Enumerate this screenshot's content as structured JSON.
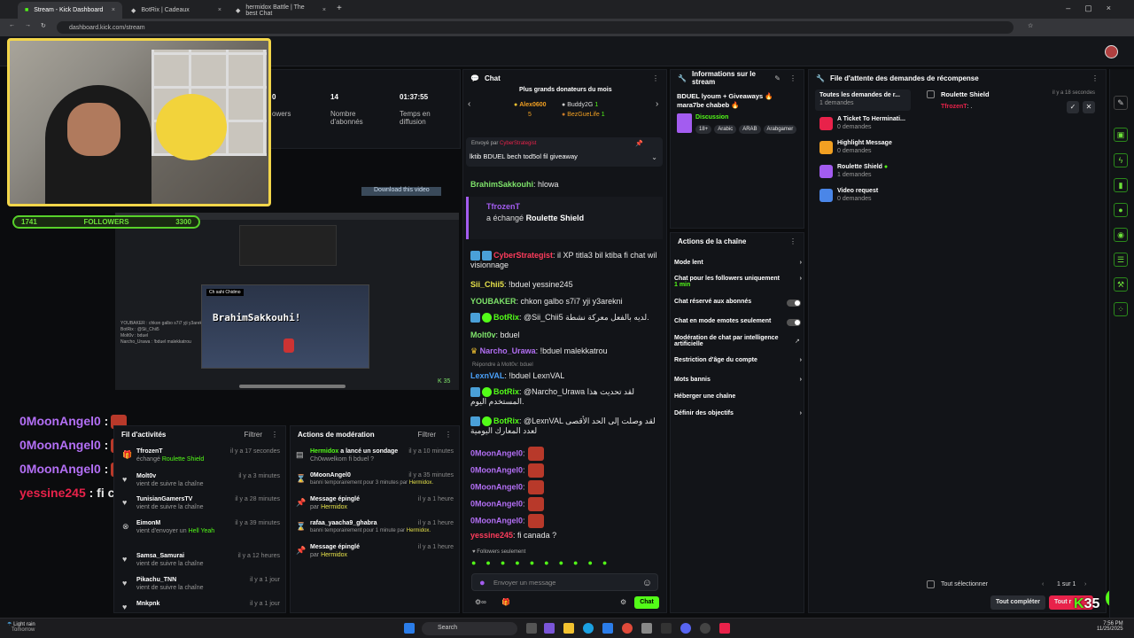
{
  "browser": {
    "tabs": [
      {
        "label": "Stream - Kick Dashboard",
        "active": true
      },
      {
        "label": "BotRix | Cadeaux",
        "active": false
      },
      {
        "label": "hermidox Battle | The best Chat",
        "active": false
      }
    ],
    "url": "dashboard.kick.com/stream"
  },
  "stats": [
    {
      "value": "0",
      "label": "owers"
    },
    {
      "value": "14",
      "label": "Nombre d'abonnés"
    },
    {
      "value": "01:37:55",
      "label": "Temps en diffusion"
    }
  ],
  "overlay": {
    "followers_current": "1741",
    "followers_label": "FOLLOWERS",
    "followers_goal": "3300",
    "download_label": "Download this video",
    "game_title": "BrahimSakkouhi!",
    "counter": "35",
    "chat": [
      {
        "user": "0MoonAngel0",
        "sep": " :",
        "color": "purple"
      },
      {
        "user": "0MoonAngel0",
        "sep": " :",
        "color": "purple"
      },
      {
        "user": "0MoonAngel0",
        "sep": " :",
        "color": "purple"
      },
      {
        "user": "yessine245",
        "sep": " : fi canada ?",
        "color": "red"
      }
    ]
  },
  "activity": {
    "title": "Fil d'activités",
    "filter": "Filtrer",
    "items": [
      {
        "name": "TfrozenT",
        "sub": "échangé",
        "sub_highlight": "Roulette Shield",
        "time": "il y a 17 secondes",
        "icon": "gift-icon"
      },
      {
        "name": "Molt0v",
        "sub": "vient de suivre la chaîne",
        "time": "il y a 3 minutes",
        "icon": "heart-icon"
      },
      {
        "name": "TunisianGamersTV",
        "sub": "vient de suivre la chaîne",
        "time": "il y a 28 minutes",
        "icon": "heart-icon"
      },
      {
        "name": "EimonM",
        "sub": "vient d'envoyer un",
        "sub_highlight": "Hell Yeah",
        "time": "il y a 39 minutes",
        "icon": "kick-icon"
      },
      {
        "name": "Samsa_Samurai",
        "sub": "vient de suivre la chaîne",
        "time": "il y a 12 heures",
        "icon": "heart-icon"
      },
      {
        "name": "Pikachu_TNN",
        "sub": "vient de suivre la chaîne",
        "time": "il y a 1 jour",
        "icon": "heart-icon"
      },
      {
        "name": "Mnkpnk",
        "sub": "",
        "time": "il y a 1 jour",
        "icon": "heart-icon"
      }
    ]
  },
  "moderation": {
    "title": "Actions de modération",
    "filter": "Filtrer",
    "items": [
      {
        "name": "Hermidox",
        "name_suffix": " a lancé un sondage",
        "sub": "Ch0wwelkom fi bduel ?",
        "time": "il y a 10 minutes",
        "icon": "poll-icon"
      },
      {
        "name": "0MoonAngel0",
        "sub": "banni temporairement pour 3 minutes par",
        "sub_highlight": "Hermidox.",
        "time": "il y a 35 minutes",
        "icon": "hourglass-icon"
      },
      {
        "name": "Message épinglé",
        "sub": "par",
        "sub_highlight": "Hermidox",
        "time": "il y a 1 heure",
        "icon": "pin-icon"
      },
      {
        "name": "rafaa_yaacha9_ghabra",
        "sub": "banni temporairement pour 1 minute par",
        "sub_highlight": "Hermidox.",
        "time": "il y a 1 heure",
        "icon": "hourglass-icon"
      },
      {
        "name": "Message épinglé",
        "sub": "par",
        "sub_highlight": "Hermidox",
        "time": "il y a 1 heure",
        "icon": "pin-icon"
      }
    ]
  },
  "chat": {
    "title": "Chat",
    "donors_title": "Plus grands donateurs du mois",
    "donors": [
      {
        "name": "Alex0600",
        "amount": "5"
      },
      {
        "name": "Buddy2G",
        "amount": "1"
      },
      {
        "name": "BezGueLife",
        "amount": "1"
      }
    ],
    "pinned_label": "Envoyé par",
    "pinned_user": "CyberStrategist",
    "pinned_text": "lktib BDUEL bech tod5ol fil giveaway",
    "redeem_user": "TfrozenT",
    "redeem_text": "a échangé",
    "redeem_item": "Roulette Shield",
    "reply_label": "Répondre à Molt0v: bduel",
    "messages": [
      {
        "user": "BrahimSakkouhi",
        "text": ": hlowa",
        "color": "#7ee36a"
      },
      {
        "user": "CyberStrategist",
        "text": ": il XP titla3 bil ktiba fi chat wil visionnage",
        "color": "#ff3c5c"
      },
      {
        "user": "Sii_Chii5",
        "text": ": !bduel yessine245",
        "color": "#e7e24a"
      },
      {
        "user": "YOUBAKER",
        "text": ": chkon galbo s7i7 yji y3arekni",
        "color": "#7ee36a"
      },
      {
        "user": "BotRix",
        "text": ": @Sii_Chii5 لديه بالفعل معركة نشطة.",
        "color": "#53fc18"
      },
      {
        "user": "Molt0v",
        "text": ": bduel",
        "color": "#7ee36a"
      },
      {
        "user": "Narcho_Urawa",
        "text": ": !bduel malekkatrou",
        "color": "#b36ff5"
      },
      {
        "user": "LexnVAL",
        "text": ": !bduel LexnVAL",
        "color": "#4aa0f8"
      },
      {
        "user": "BotRix",
        "text": ": @Narcho_Urawa لقد تحديت هذا المستخدم اليوم.",
        "color": "#53fc18"
      },
      {
        "user": "BotRix",
        "text": ": @LexnVAL لقد وصلت إلى الحد الأقصى لعدد المعارك اليومية",
        "color": "#53fc18"
      },
      {
        "user": "0MoonAngel0",
        "text": ":",
        "color": "#b36ff5"
      },
      {
        "user": "0MoonAngel0",
        "text": ":",
        "color": "#b36ff5"
      },
      {
        "user": "0MoonAngel0",
        "text": ":",
        "color": "#b36ff5"
      },
      {
        "user": "0MoonAngel0",
        "text": ":",
        "color": "#b36ff5"
      },
      {
        "user": "0MoonAngel0",
        "text": ":",
        "color": "#b36ff5"
      },
      {
        "user": "yessine245",
        "text": ": fi canada ?",
        "color": "#ff3c5c"
      }
    ],
    "followers_only": "Followers seulement",
    "input_placeholder": "Envoyer un message",
    "send_label": "Chat"
  },
  "stream_info": {
    "title": "Informations sur le stream",
    "stream_title": "BDUEL lyoum + Giveaways 🔥 mara7be chabeb 🔥",
    "category": "Discussion",
    "tags": [
      "18+",
      "Arabic",
      "ARAB",
      "Arabgamer"
    ]
  },
  "channel_actions": {
    "title": "Actions de la chaîne",
    "items": [
      {
        "label": "Mode lent",
        "control": "chevron"
      },
      {
        "label": "Chat pour les followers uniquement",
        "sub": "1 min",
        "control": "chevron"
      },
      {
        "label": "Chat réservé aux abonnés",
        "control": "toggle"
      },
      {
        "label": "Chat en mode emotes seulement",
        "control": "toggle"
      },
      {
        "label": "Modération de chat par intelligence artificielle",
        "control": "external"
      },
      {
        "label": "Restriction d'âge du compte",
        "control": "chevron"
      },
      {
        "label": "Mots bannis",
        "control": "chevron"
      },
      {
        "label": "Héberger une chaîne",
        "control": "none"
      },
      {
        "label": "Définir des objectifs",
        "control": "chevron"
      }
    ]
  },
  "rewards": {
    "title": "File d'attente des demandes de récompense",
    "categories": [
      {
        "label": "Toutes les demandes de r...",
        "sub": "1 demandes",
        "color": ""
      },
      {
        "label": "A Ticket To Herminati...",
        "sub": "0 demandes",
        "color": "#e8224a"
      },
      {
        "label": "Highlight Message",
        "sub": "0 demandes",
        "color": "#f2a022"
      },
      {
        "label": "Roulette Shield",
        "sub": "1 demandes",
        "color": "#a35cf0"
      },
      {
        "label": "Video request",
        "sub": "0 demandes",
        "color": "#4a86e8"
      }
    ],
    "request": {
      "reward": "Roulette Shield",
      "time": "il y a 18 secondes",
      "user": "TfrozenT",
      "text": ": ."
    },
    "select_all": "Tout sélectionner",
    "page": "1 sur 1",
    "complete_all": "Tout compléter",
    "reject_all": "Tout r"
  },
  "taskbar": {
    "weather_title": "Light rain",
    "weather_sub": "Tomorrow",
    "search": "Search",
    "time": "7:56 PM",
    "date": "11/25/2025"
  },
  "colors": {
    "kick_green": "#53fc18",
    "accent_red": "#e8224a",
    "purple": "#b36ff5"
  }
}
